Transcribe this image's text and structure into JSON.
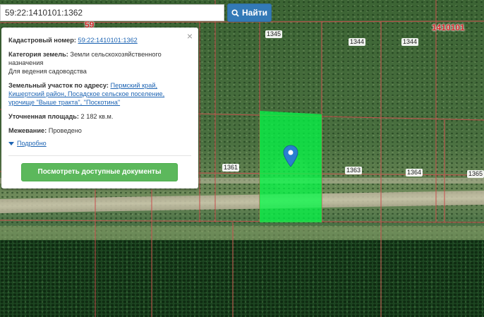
{
  "search": {
    "value": "59:22:1410101:1362",
    "button_label": "Найти"
  },
  "map": {
    "parcel_labels": [
      "1345",
      "1344",
      "1344",
      "1361",
      "1363",
      "1364",
      "1365"
    ],
    "red_labels": [
      "59",
      "1410101"
    ],
    "parcel_color": "#00ff46",
    "pin_color": "#2a7fcf"
  },
  "popup": {
    "cadastral_label": "Кадастровый номер:",
    "cadastral_value": "59:22:1410101:1362",
    "category_label": "Категория земель:",
    "category_value": "Земли сельскохозяйственного назначения",
    "usage_value": "Для ведения садоводства",
    "address_label": "Земельный участок по адресу:",
    "address_value": "Пермский край, Кишертский район, Посадское сельское поселение, урочище \"Выше тракта\", \"Поскотина\"",
    "area_label": "Уточненная площадь:",
    "area_value": "2 182 кв.м.",
    "survey_label": "Межевание:",
    "survey_value": "Проведено",
    "more_label": "Подробно",
    "docs_button": "Посмотреть доступные документы",
    "close_symbol": "×"
  }
}
